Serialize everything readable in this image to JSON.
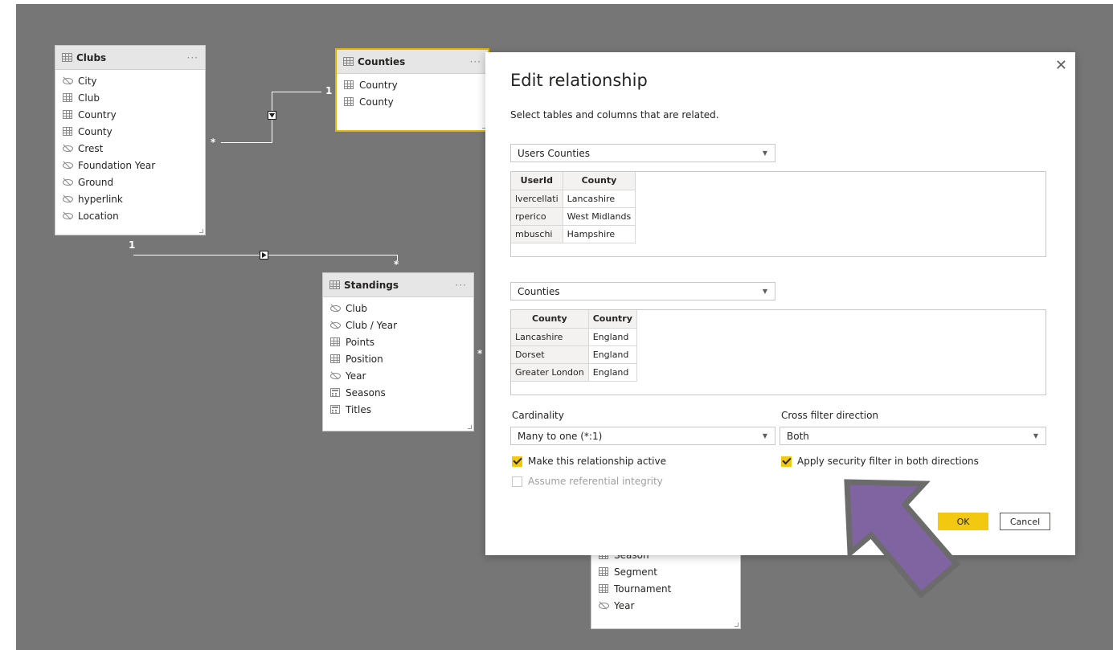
{
  "colors": {
    "canvas": "#767676",
    "accent": "#f2c811",
    "callout": "#8064a2",
    "callout_border": "#6b6b6b"
  },
  "diagram": {
    "clubs": {
      "title": "Clubs",
      "fields": [
        {
          "name": "City",
          "icon": "hidden-eye-icon"
        },
        {
          "name": "Club",
          "icon": "table-column-icon"
        },
        {
          "name": "Country",
          "icon": "table-column-icon"
        },
        {
          "name": "County",
          "icon": "table-column-icon"
        },
        {
          "name": "Crest",
          "icon": "hidden-eye-icon"
        },
        {
          "name": "Foundation Year",
          "icon": "hidden-eye-icon"
        },
        {
          "name": "Ground",
          "icon": "hidden-eye-icon"
        },
        {
          "name": "hyperlink",
          "icon": "hidden-eye-icon"
        },
        {
          "name": "Location",
          "icon": "hidden-eye-icon"
        }
      ]
    },
    "counties": {
      "title": "Counties",
      "fields": [
        {
          "name": "Country",
          "icon": "table-column-icon"
        },
        {
          "name": "County",
          "icon": "table-column-icon"
        }
      ]
    },
    "standings": {
      "title": "Standings",
      "fields": [
        {
          "name": "Club",
          "icon": "hidden-eye-icon"
        },
        {
          "name": "Club / Year",
          "icon": "hidden-eye-icon"
        },
        {
          "name": "Points",
          "icon": "table-column-icon"
        },
        {
          "name": "Position",
          "icon": "table-column-icon"
        },
        {
          "name": "Year",
          "icon": "hidden-eye-icon"
        },
        {
          "name": "Seasons",
          "icon": "calculator-icon"
        },
        {
          "name": "Titles",
          "icon": "calculator-icon"
        }
      ]
    },
    "bottom_table": {
      "fields": [
        {
          "name": "Season",
          "icon": "table-column-icon"
        },
        {
          "name": "Segment",
          "icon": "table-column-icon"
        },
        {
          "name": "Tournament",
          "icon": "table-column-icon"
        },
        {
          "name": "Year",
          "icon": "hidden-eye-icon"
        }
      ]
    },
    "relationships": {
      "clubs_counties_one": "1",
      "clubs_counties_many": "*",
      "clubs_standings_one": "1",
      "clubs_standings_many": "*",
      "standings_side_many": "*"
    }
  },
  "dialog": {
    "title": "Edit relationship",
    "subtitle": "Select tables and columns that are related.",
    "close_glyph": "✕",
    "table1": {
      "selected": "Users Counties",
      "columns": [
        "UserId",
        "County"
      ],
      "rows": [
        [
          "lvercellati",
          "Lancashire"
        ],
        [
          "rperico",
          "West Midlands"
        ],
        [
          "mbuschi",
          "Hampshire"
        ]
      ]
    },
    "table2": {
      "selected": "Counties",
      "columns": [
        "County",
        "Country"
      ],
      "rows": [
        [
          "Lancashire",
          "England"
        ],
        [
          "Dorset",
          "England"
        ],
        [
          "Greater London",
          "England"
        ]
      ]
    },
    "cardinality": {
      "label": "Cardinality",
      "value": "Many to one (*:1)"
    },
    "cross_filter": {
      "label": "Cross filter direction",
      "value": "Both"
    },
    "checks": {
      "active": {
        "label": "Make this relationship active",
        "checked": true
      },
      "referential": {
        "label": "Assume referential integrity",
        "checked": false,
        "disabled": true
      },
      "security": {
        "label": "Apply security filter in both directions",
        "checked": true
      }
    },
    "ok_label": "OK",
    "cancel_label": "Cancel"
  }
}
